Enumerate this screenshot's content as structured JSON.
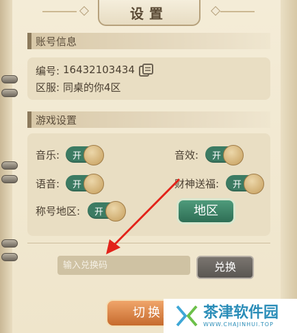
{
  "title": "设置",
  "account": {
    "section_title": "账号信息",
    "id_label": "编号:",
    "id_value": "16432103434",
    "server_label": "区服:",
    "server_value": "同桌的你4区"
  },
  "game_settings": {
    "section_title": "游戏设置",
    "toggles": [
      {
        "label": "音乐:",
        "state": "开"
      },
      {
        "label": "音效:",
        "state": "开"
      },
      {
        "label": "语音:",
        "state": "开"
      },
      {
        "label": "财神送福:",
        "state": "开"
      },
      {
        "label": "称号地区:",
        "state": "开"
      }
    ],
    "region_button": "地区"
  },
  "redeem": {
    "placeholder": "输入兑换码",
    "button": "兑换"
  },
  "switch_button": "切换账",
  "watermark": {
    "main": "茶津软件园",
    "sub": "WWW.CHAJINHUI.TOP"
  },
  "colors": {
    "accent_green": "#3c7b63",
    "switch_orange": "#d57a3a",
    "arrow_red": "#e2231a"
  }
}
